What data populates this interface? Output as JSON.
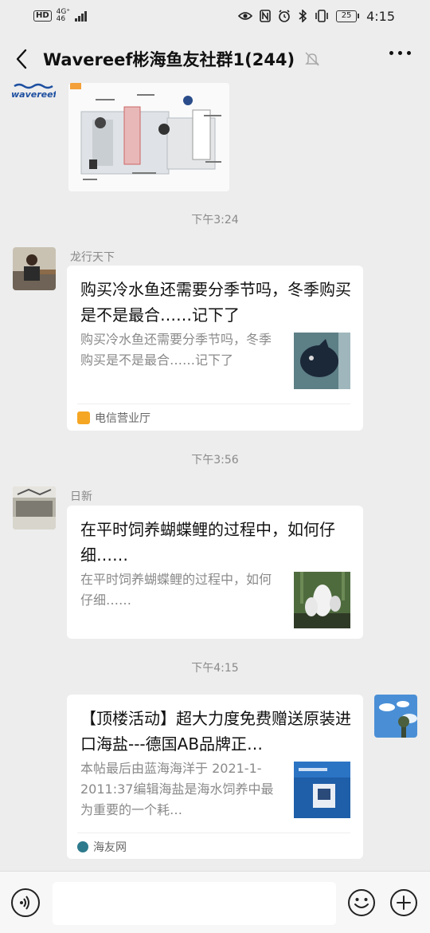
{
  "status_bar": {
    "hd": "HD",
    "network": "4G⁺",
    "network_sub": "46",
    "battery": "25",
    "time": "4:15"
  },
  "nav": {
    "title": "Wavereef彬海鱼友社群1(244)"
  },
  "chat": {
    "partial_image": {
      "brand": "wavereef"
    },
    "messages": [
      {
        "timestamp": "下午3:24",
        "sender": "龙行天下",
        "title": "购买冷水鱼还需要分季节吗，冬季购买是不是最合……记下了",
        "description": "购买冷水鱼还需要分季节吗，冬季购买是不是最合……记下了",
        "source": "电信营业厅"
      },
      {
        "timestamp": "下午3:56",
        "sender": "日新",
        "title": "在平时饲养蝴蝶鲤的过程中，如何仔细……",
        "description": "在平时饲养蝴蝶鲤的过程中，如何仔细……"
      },
      {
        "timestamp": "下午4:15",
        "title": "【顶楼活动】超大力度免费赠送原装进口海盐---德国AB品牌正…",
        "description": "本帖最后由蓝海海洋于 2021-1-2011:37编辑海盐是海水饲养中最为重要的一个耗…",
        "source": "海友网"
      }
    ]
  },
  "input_bar": {
    "placeholder": ""
  },
  "colors": {
    "background": "#ededed",
    "card": "#ffffff",
    "muted_text": "#8a8a8a",
    "input_bar": "#f7f7f7"
  },
  "icons": {
    "back": "chevron-left-icon",
    "mute": "bell-muted-icon",
    "more": "more-dots-icon",
    "voice": "voice-icon",
    "emoji": "emoji-icon",
    "plus": "plus-icon"
  }
}
